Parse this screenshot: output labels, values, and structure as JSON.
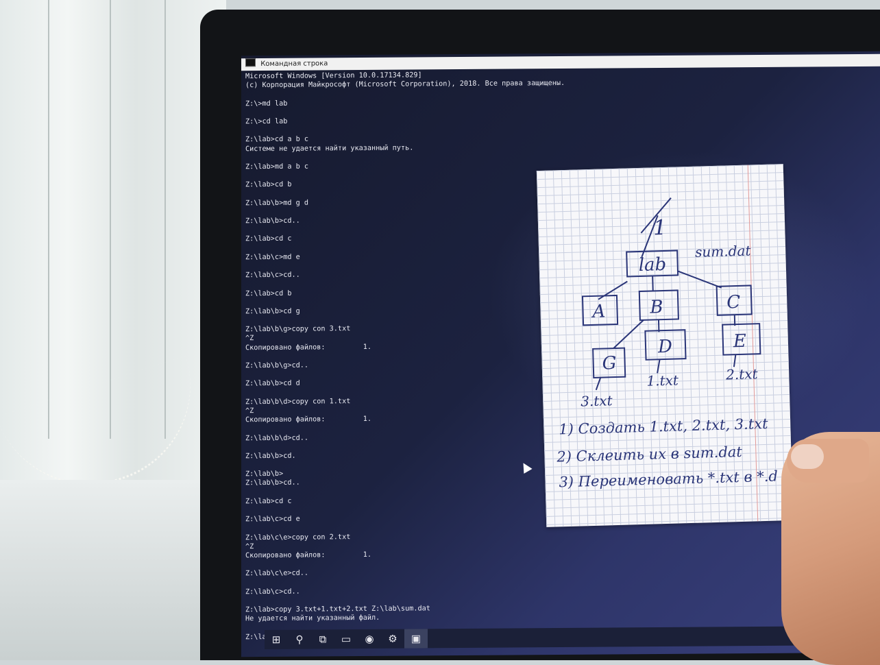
{
  "window": {
    "title": "Командная строка"
  },
  "console_lines": [
    "Microsoft Windows [Version 10.0.17134.829]",
    "(c) Корпорация Майкрософт (Microsoft Corporation), 2018. Все права защищены.",
    "",
    "Z:\\>md lab",
    "",
    "Z:\\>cd lab",
    "",
    "Z:\\lab>cd a b c",
    "Системе не удается найти указанный путь.",
    "",
    "Z:\\lab>md a b c",
    "",
    "Z:\\lab>cd b",
    "",
    "Z:\\lab\\b>md g d",
    "",
    "Z:\\lab\\b>cd..",
    "",
    "Z:\\lab>cd c",
    "",
    "Z:\\lab\\c>md e",
    "",
    "Z:\\lab\\c>cd..",
    "",
    "Z:\\lab>cd b",
    "",
    "Z:\\lab\\b>cd g",
    "",
    "Z:\\lab\\b\\g>copy con 3.txt",
    "^Z",
    "Скопировано файлов:         1.",
    "",
    "Z:\\lab\\b\\g>cd..",
    "",
    "Z:\\lab\\b>cd d",
    "",
    "Z:\\lab\\b\\d>copy con 1.txt",
    "^Z",
    "Скопировано файлов:         1.",
    "",
    "Z:\\lab\\b\\d>cd..",
    "",
    "Z:\\lab\\b>cd.",
    "",
    "Z:\\lab\\b>",
    "Z:\\lab\\b>cd..",
    "",
    "Z:\\lab>cd c",
    "",
    "Z:\\lab\\c>cd e",
    "",
    "Z:\\lab\\c\\e>copy con 2.txt",
    "^Z",
    "Скопировано файлов:         1.",
    "",
    "Z:\\lab\\c\\e>cd..",
    "",
    "Z:\\lab\\c>cd..",
    "",
    "Z:\\lab>copy 3.txt+1.txt+2.txt Z:\\lab\\sum.dat",
    "Не удается найти указанный файл.",
    "",
    "Z:\\lab>copy *.txt sam.dat"
  ],
  "taskbar": {
    "icons": [
      "windows-start-icon",
      "search-icon",
      "task-view-icon",
      "file-explorer-icon",
      "chrome-icon",
      "settings-gear-icon",
      "command-prompt-icon"
    ],
    "glyphs": [
      "⊞",
      "⚲",
      "⧉",
      "▭",
      "◉",
      "⚙",
      "▣"
    ]
  },
  "note": {
    "root": "1",
    "tree": {
      "root_box": "lab",
      "root_file": "sum.dat",
      "children": [
        "A",
        "B",
        "C"
      ],
      "b_children": [
        "G",
        "D"
      ],
      "c_children": [
        "E"
      ],
      "files": [
        "3.txt",
        "1.txt",
        "2.txt"
      ]
    },
    "tasks": [
      "1) Создать 1.txt, 2.txt, 3.txt",
      "2) Склеить их в sum.dat",
      "3) Переименовать *.txt в *.d"
    ]
  },
  "colors": {
    "ink": "#2a3578",
    "console_text": "#e9eaf2",
    "desktop": "#1c2240"
  }
}
